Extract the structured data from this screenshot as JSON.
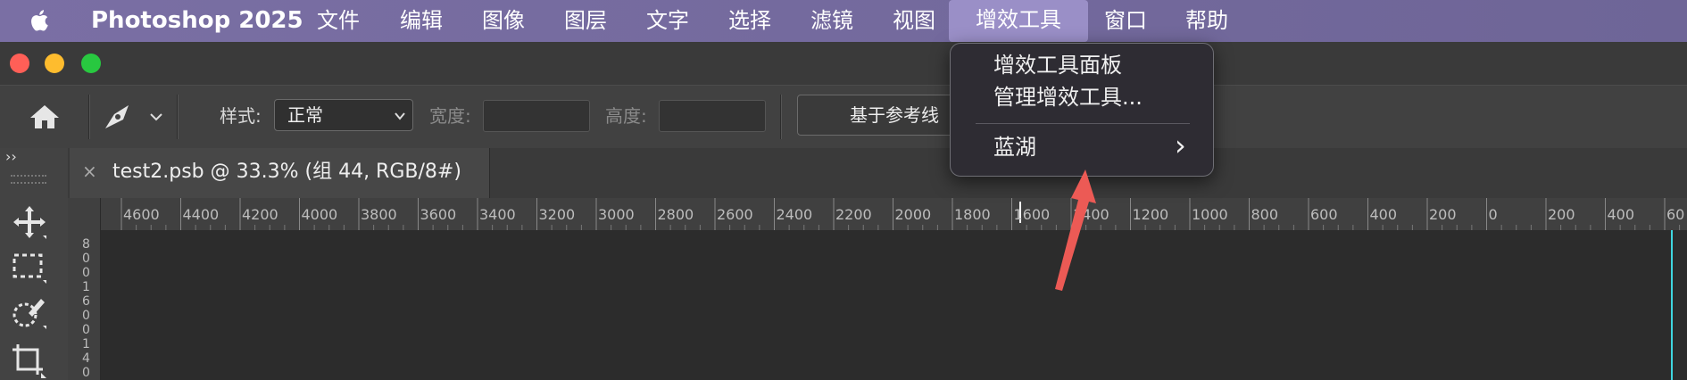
{
  "menubar": {
    "app_name": "Photoshop 2025",
    "items": [
      "文件",
      "编辑",
      "图像",
      "图层",
      "文字",
      "选择",
      "滤镜",
      "视图",
      "增效工具",
      "窗口",
      "帮助"
    ],
    "active_item": "增效工具"
  },
  "options_bar": {
    "style_label": "样式:",
    "style_value": "正常",
    "width_label": "宽度:",
    "height_label": "高度:",
    "guides_button": "基于参考线"
  },
  "document": {
    "tab_title": "test2.psb @ 33.3% (组 44, RGB/8#)",
    "close_glyph": "×"
  },
  "ruler": {
    "h_labels": [
      "4600",
      "4400",
      "4200",
      "4000",
      "3800",
      "3600",
      "3400",
      "3200",
      "3000",
      "2800",
      "2600",
      "2400",
      "2200",
      "2000",
      "1800",
      "1600",
      "1400",
      "1200",
      "1000",
      "800",
      "600",
      "400",
      "200",
      "0",
      "200",
      "400",
      "60"
    ],
    "v_labels": [
      "8",
      "0",
      "0",
      "1",
      "6",
      "0",
      "0",
      "1",
      "4",
      "0"
    ]
  },
  "plugins_menu": {
    "items": [
      "增效工具面板",
      "管理增效工具...",
      "蓝湖"
    ],
    "submenu_glyph": "›"
  },
  "panel_toggle": "››",
  "colors": {
    "menubar": "#7a6fa4",
    "active_menu": "#9a8fc7",
    "close_light": "#ff5f57",
    "minimize_light": "#febc2e",
    "zoom_light": "#28c840",
    "annotation_arrow": "#ec5a55"
  },
  "icons": [
    "apple-icon",
    "home-icon",
    "pen-tool-icon",
    "move-tool-icon",
    "marquee-tool-icon",
    "quick-select-icon",
    "crop-tool-icon"
  ]
}
